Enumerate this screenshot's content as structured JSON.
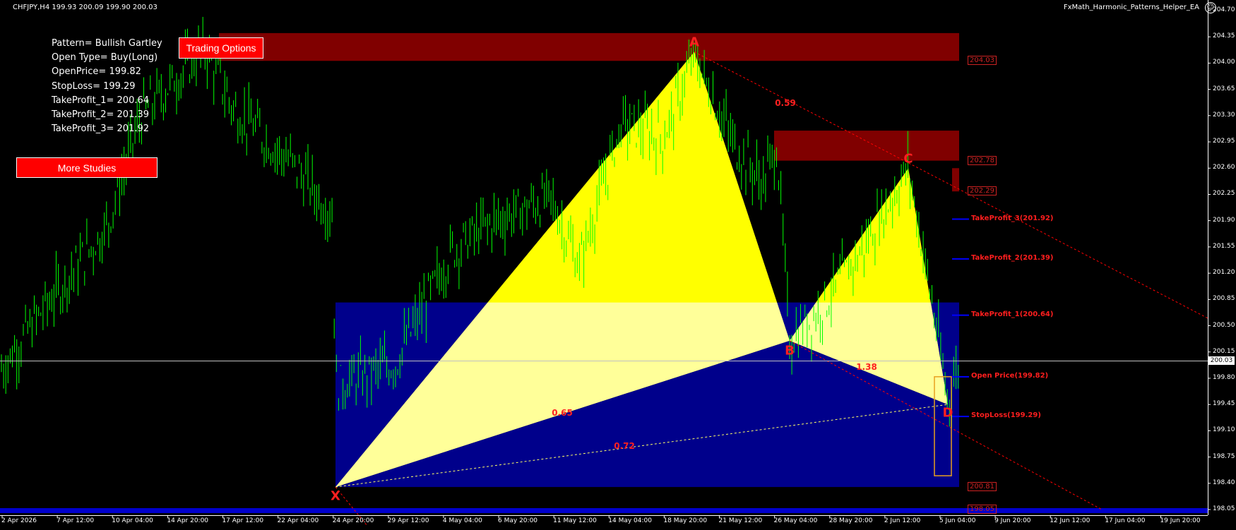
{
  "header": {
    "symbol_line": "CHFJPY,H4  199.93 200.09 199.90 200.03",
    "ea_name": "FxMath_Harmonic_Patterns_Helper_EA",
    "ea_icon": "smiley-icon"
  },
  "info_panel": {
    "lines": [
      "Pattern= Bullish Gartley",
      "Open Type= Buy(Long)",
      "OpenPrice= 199.82",
      "StopLoss= 199.29",
      "TakeProfit_1= 200.64",
      "TakeProfit_2= 201.39",
      "TakeProfit_3= 201.92"
    ]
  },
  "buttons": {
    "trading_options": "Trading Options",
    "more_studies": "More Studies"
  },
  "colors": {
    "background": "#000000",
    "candle": "#00ff00",
    "pattern_fill": "#ffff00",
    "pattern_fill_light": "#ffff99",
    "blue_zone": "#00008b",
    "red_zone": "#800000",
    "level_text": "#ff1e1e",
    "level_line": "#0000ff",
    "dashed_line": "#ff0000",
    "current_price_line": "#c0c0c0"
  },
  "price_axis": {
    "ticks": [
      "204.70",
      "204.35",
      "204.00",
      "203.65",
      "203.30",
      "202.95",
      "202.60",
      "202.25",
      "201.90",
      "201.55",
      "201.20",
      "200.85",
      "200.50",
      "200.15",
      "199.80",
      "199.45",
      "199.10",
      "198.75",
      "198.40",
      "198.05"
    ],
    "tick_values": [
      204.7,
      204.35,
      204.0,
      203.65,
      203.3,
      202.95,
      202.6,
      202.25,
      201.9,
      201.55,
      201.2,
      200.85,
      200.5,
      200.15,
      199.8,
      199.45,
      199.1,
      198.75,
      198.4,
      198.05
    ],
    "current_price": "200.03",
    "current_value": 200.03
  },
  "time_axis": {
    "ticks": [
      "2 Apr 2026",
      "7 Apr 12:00",
      "10 Apr 04:00",
      "14 Apr 20:00",
      "17 Apr 12:00",
      "22 Apr 04:00",
      "24 Apr 20:00",
      "29 Apr 12:00",
      "4 May 04:00",
      "6 May 20:00",
      "11 May 12:00",
      "14 May 04:00",
      "18 May 20:00",
      "21 May 12:00",
      "26 May 04:00",
      "28 May 20:00",
      "2 Jun 12:00",
      "5 Jun 04:00",
      "9 Jun 20:00",
      "12 Jun 12:00",
      "17 Jun 04:00",
      "19 Jun 20:00"
    ]
  },
  "pattern": {
    "points": [
      {
        "label": "X",
        "price": 198.35
      },
      {
        "label": "A",
        "price": 204.15
      },
      {
        "label": "B",
        "price": 200.3
      },
      {
        "label": "C",
        "price": 202.6
      },
      {
        "label": "D",
        "price": 199.45
      }
    ],
    "ratios": [
      {
        "label": "0.59"
      },
      {
        "label": "0.65"
      },
      {
        "label": "1.38"
      },
      {
        "label": "0.72"
      }
    ]
  },
  "zones": [
    {
      "label": "204.03",
      "top": 204.4,
      "bottom": 204.03,
      "color": "#800000"
    },
    {
      "label": "202.78",
      "top": 203.1,
      "bottom": 202.7,
      "color": "#800000"
    },
    {
      "label": "202.29",
      "top": 202.6,
      "bottom": 202.29,
      "color": "#800000"
    },
    {
      "label": "200.81",
      "top": 200.81,
      "bottom": 198.35,
      "color": "#00008b"
    }
  ],
  "levels": [
    {
      "label": "TakeProfit_3(201.92)",
      "price": 201.92
    },
    {
      "label": "TakeProfit_2(201.39)",
      "price": 201.39
    },
    {
      "label": "TakeProfit_1(200.64)",
      "price": 200.64
    },
    {
      "label": "Open Price(199.82)",
      "price": 199.82
    },
    {
      "label": "StopLoss(199.29)",
      "price": 199.29
    }
  ],
  "bottom_zone_label": "198.05"
}
